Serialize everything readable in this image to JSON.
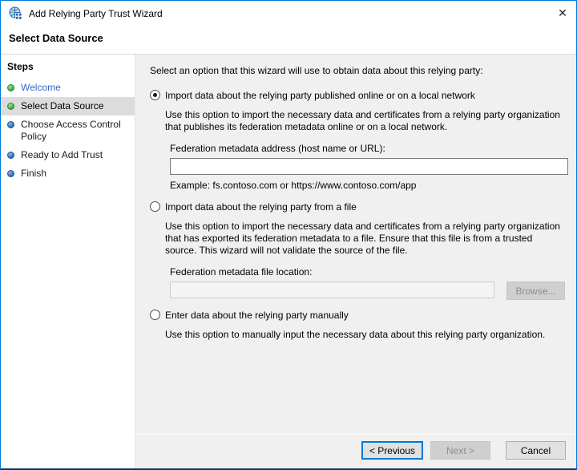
{
  "window": {
    "title": "Add Relying Party Trust Wizard",
    "close_glyph": "✕"
  },
  "page": {
    "heading": "Select Data Source"
  },
  "sidebar": {
    "heading": "Steps",
    "items": [
      {
        "label": "Welcome",
        "state": "done"
      },
      {
        "label": "Select Data Source",
        "state": "current"
      },
      {
        "label": "Choose Access Control Policy",
        "state": "pending"
      },
      {
        "label": "Ready to Add Trust",
        "state": "pending"
      },
      {
        "label": "Finish",
        "state": "pending"
      }
    ]
  },
  "content": {
    "intro": "Select an option that this wizard will use to obtain data about this relying party:",
    "selected_option": "online",
    "option_online": {
      "label": "Import data about the relying party published online or on a local network",
      "description": "Use this option to import the necessary data and certificates from a relying party organization that publishes its federation metadata online or on a local network.",
      "address_label": "Federation metadata address (host name or URL):",
      "address_value": "",
      "example": "Example: fs.contoso.com or https://www.contoso.com/app"
    },
    "option_file": {
      "label": "Import data about the relying party from a file",
      "description": "Use this option to import the necessary data and certificates from a relying party organization that has exported its federation metadata to a file. Ensure that this file is from a trusted source.  This wizard will not validate the source of the file.",
      "file_label": "Federation metadata file location:",
      "file_value": "",
      "browse_label": "Browse..."
    },
    "option_manual": {
      "label": "Enter data about the relying party manually",
      "description": "Use this option to manually input the necessary data about this relying party organization."
    }
  },
  "footer": {
    "previous_label": "< Previous",
    "next_label": "Next >",
    "cancel_label": "Cancel"
  },
  "colors": {
    "accent": "#0078d7",
    "step_done_bullet": "#3aa53f",
    "step_pending_bullet": "#2b66b0",
    "step_link_text": "#3366cc",
    "current_step_highlight": "#dcdcdc",
    "panel_background": "#f0f0f0"
  }
}
